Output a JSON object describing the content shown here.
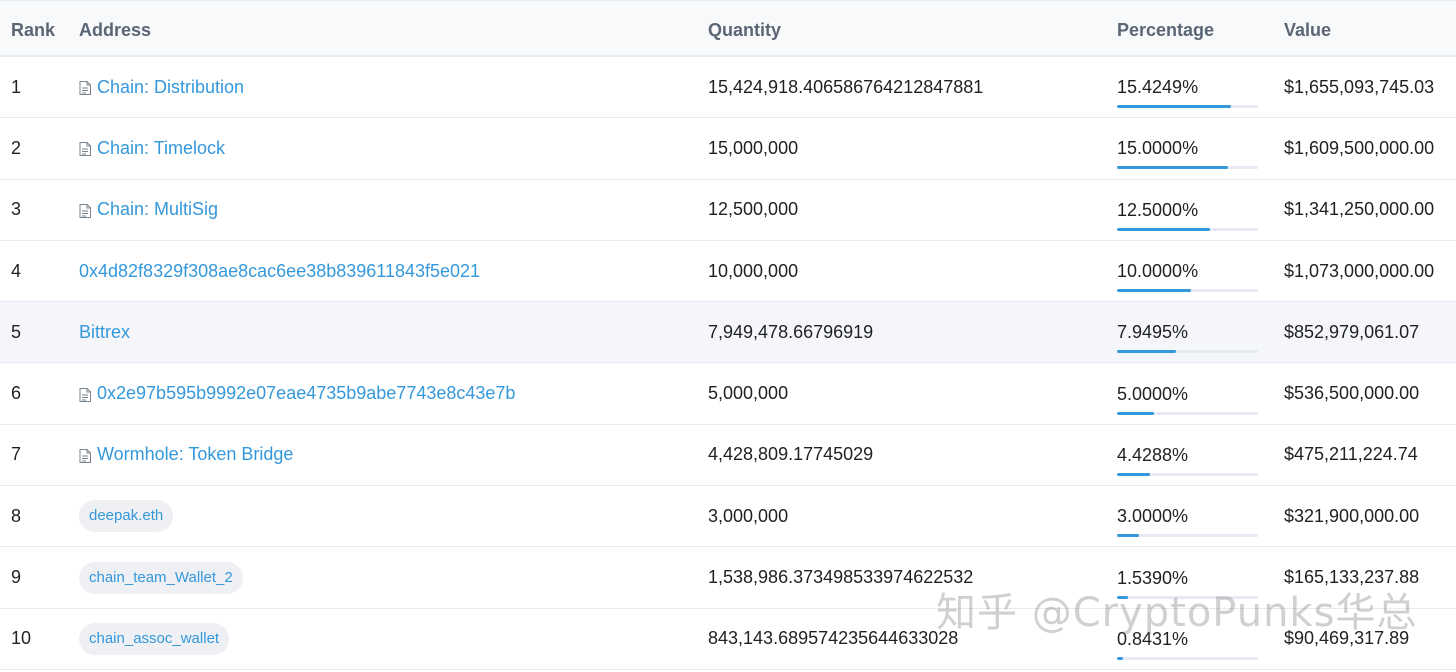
{
  "table": {
    "headers": {
      "rank": "Rank",
      "address": "Address",
      "quantity": "Quantity",
      "percentage": "Percentage",
      "value": "Value"
    },
    "rows": [
      {
        "rank": "1",
        "address": "Chain: Distribution",
        "address_style": "contract",
        "quantity": "15,424,918.406586764212847881",
        "percentage": "15.4249%",
        "pct_value": 15.4249,
        "value": "$1,655,093,745.03"
      },
      {
        "rank": "2",
        "address": "Chain: Timelock",
        "address_style": "contract",
        "quantity": "15,000,000",
        "percentage": "15.0000%",
        "pct_value": 15.0,
        "value": "$1,609,500,000.00"
      },
      {
        "rank": "3",
        "address": "Chain: MultiSig",
        "address_style": "contract",
        "quantity": "12,500,000",
        "percentage": "12.5000%",
        "pct_value": 12.5,
        "value": "$1,341,250,000.00"
      },
      {
        "rank": "4",
        "address": "0x4d82f8329f308ae8cac6ee38b839611843f5e021",
        "address_style": "plain",
        "quantity": "10,000,000",
        "percentage": "10.0000%",
        "pct_value": 10.0,
        "value": "$1,073,000,000.00"
      },
      {
        "rank": "5",
        "address": "Bittrex",
        "address_style": "plain",
        "quantity": "7,949,478.66796919",
        "percentage": "7.9495%",
        "pct_value": 7.9495,
        "value": "$852,979,061.07"
      },
      {
        "rank": "6",
        "address": "0x2e97b595b9992e07eae4735b9abe7743e8c43e7b",
        "address_style": "contract",
        "quantity": "5,000,000",
        "percentage": "5.0000%",
        "pct_value": 5.0,
        "value": "$536,500,000.00"
      },
      {
        "rank": "7",
        "address": "Wormhole: Token Bridge",
        "address_style": "contract",
        "quantity": "4,428,809.17745029",
        "percentage": "4.4288%",
        "pct_value": 4.4288,
        "value": "$475,211,224.74"
      },
      {
        "rank": "8",
        "address": "deepak.eth",
        "address_style": "tag",
        "quantity": "3,000,000",
        "percentage": "3.0000%",
        "pct_value": 3.0,
        "value": "$321,900,000.00"
      },
      {
        "rank": "9",
        "address": "chain_team_Wallet_2",
        "address_style": "tag",
        "quantity": "1,538,986.373498533974622532",
        "percentage": "1.5390%",
        "pct_value": 1.539,
        "value": "$165,133,237.88"
      },
      {
        "rank": "10",
        "address": "chain_assoc_wallet",
        "address_style": "tag",
        "quantity": "843,143.689574235644633028",
        "percentage": "0.8431%",
        "pct_value": 0.8431,
        "value": "$90,469,317.89"
      }
    ],
    "highlighted_row": 5,
    "pct_bar_scale_max": 19
  },
  "watermark": "知乎 @CryptoPunks华总",
  "colors": {
    "link": "#3498db",
    "bar_fill": "#3498db",
    "bar_track": "#e7eaf3",
    "header_bg": "#f8f9fa",
    "highlight_row_bg": "#f4f6f9"
  }
}
